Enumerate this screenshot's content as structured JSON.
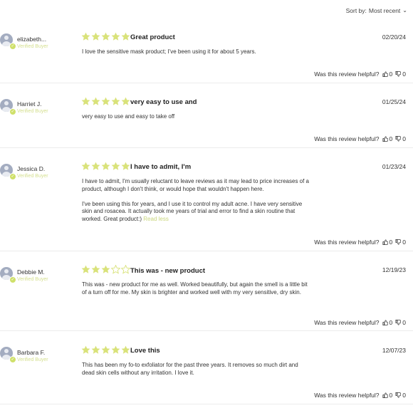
{
  "sort": {
    "label": "Sort by:",
    "value": "Most recent"
  },
  "helpful_label": "Was this review helpful?",
  "verified_label": "Verified Buyer",
  "read_less_label": "Read less",
  "colors": {
    "star": "#d9e27a",
    "star_empty": "#d9e27a",
    "verified": "#d4df8e",
    "avatar": "#a3acc0"
  },
  "reviews": [
    {
      "author": "elizabeth...",
      "rating": 5,
      "title": "Great product",
      "date": "02/20/24",
      "paragraphs": [
        "I love the sensitive mask product; I've been using it for about 5 years."
      ],
      "up": "0",
      "down": "0"
    },
    {
      "author": "Harriet J.",
      "rating": 5,
      "title": "very easy to use and",
      "date": "01/25/24",
      "paragraphs": [
        "very easy to use and easy to take off"
      ],
      "up": "0",
      "down": "0"
    },
    {
      "author": "Jessica D.",
      "rating": 5,
      "title": "I have to admit, I'm",
      "date": "01/23/24",
      "paragraphs": [
        "I have to admit, I'm usually reluctant to leave reviews as it may lead to price increases of a product, although I don't think, or would hope that wouldn't happen here.",
        "I've been using this for years, and I use it to control my adult acne. I have very sensitive skin and rosacea. It actually took me years of trial and error to find a skin routine that worked. Great product:)"
      ],
      "up": "0",
      "down": "0"
    },
    {
      "author": "Debbie M.",
      "rating": 3,
      "title": "This was - new product",
      "date": "12/19/23",
      "paragraphs": [
        "This was - new product for me as well. Worked beautifully, but again the smell is a little bit of a turn off for me. My skin is brighter and worked well with my very sensitive, dry skin."
      ],
      "up": "0",
      "down": "0"
    },
    {
      "author": "Barbara F.",
      "rating": 5,
      "title": "Love this",
      "date": "12/07/23",
      "paragraphs": [
        "This has been my fo-to exfoliator for the past three years. It removes so much dirt and dead skin cells without any irritation. I love it."
      ],
      "up": "0",
      "down": "0"
    }
  ]
}
